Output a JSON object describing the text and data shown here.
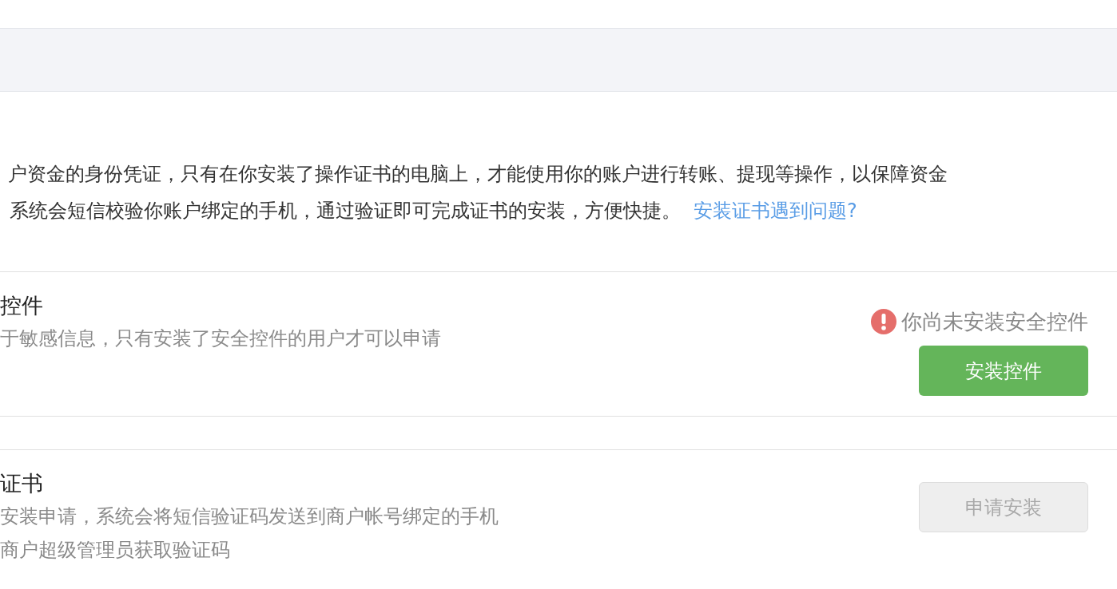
{
  "intro": {
    "lines": [
      "户资金的身份凭证，只有在你安装了操作证书的电脑上，才能使用你的账户进行转账、提现等操作，以保障资金",
      "系统会短信校验你账户绑定的手机，通过验证即可完成证书的安装，方便快捷。"
    ],
    "link": "安装证书遇到问题?"
  },
  "sections": [
    {
      "title": "控件",
      "description": [
        "于敏感信息，只有安装了安全控件的用户才可以申请"
      ],
      "warning": "你尚未安装安全控件",
      "button": {
        "label": "安装控件",
        "disabled": false
      }
    },
    {
      "title": "证书",
      "description": [
        "安装申请，系统会将短信验证码发送到商户帐号绑定的手机",
        "商户超级管理员获取验证码"
      ],
      "button": {
        "label": "申请安装",
        "disabled": true
      }
    }
  ]
}
